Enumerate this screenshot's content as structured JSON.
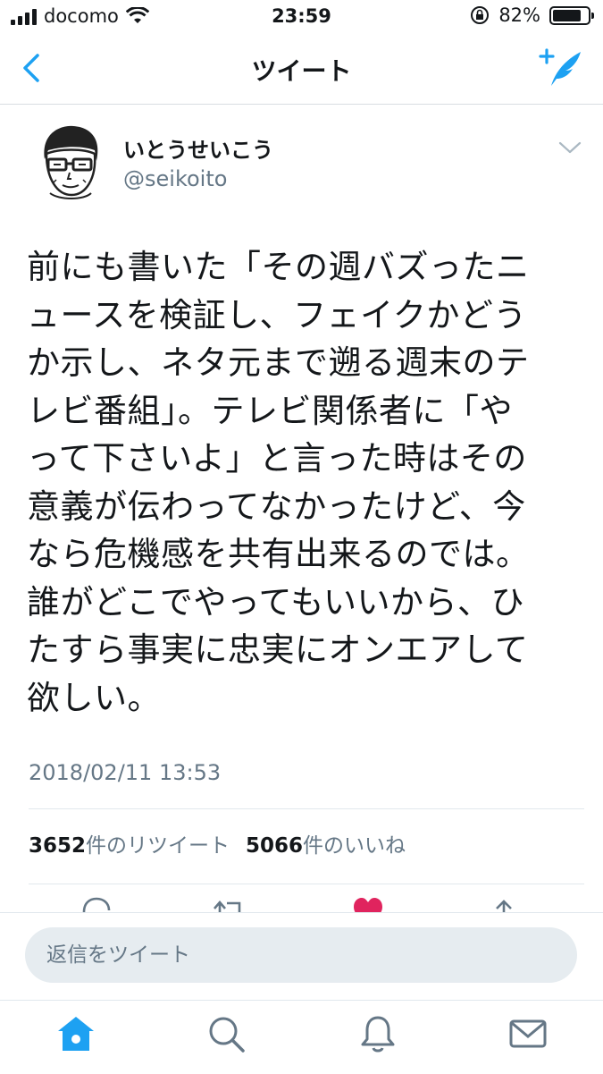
{
  "status_bar": {
    "carrier": "docomo",
    "time": "23:59",
    "battery": "82%",
    "battery_level": 0.82
  },
  "nav": {
    "title": "ツイート",
    "back_icon": "chevron-left-icon",
    "compose_icon": "compose-tweet-icon"
  },
  "tweet": {
    "display_name": "いとうせいこう",
    "handle": "@seikoito",
    "text": "前にも書いた「その週バズったニュースを検証し、フェイクかどうか示し、ネタ元まで遡る週末のテレビ番組」。テレビ関係者に「やって下さいよ」と言った時はその意義が伝わってなかったけど、今なら危機感を共有出来るのでは。誰がどこでやってもいいから、ひたすら事実に忠実にオンエアして欲しい。",
    "lines": [
      "前にも書いた「その週バズったニ",
      "ュースを検証し、フェイクかどう",
      "か示し、ネタ元まで遡る週末のテ",
      "レビ番組」。テレビ関係者に「や",
      "って下さいよ」と言った時はその",
      "意義が伝わってなかったけど、今",
      "なら危機感を共有出来るのでは。",
      "誰がどこでやってもいいから、ひ",
      "たすら事実に忠実にオンエアして",
      "欲しい。"
    ],
    "timestamp": "2018/02/11 13:53",
    "retweets_count": "3652",
    "retweets_label": "件のリツイート",
    "likes_count": "5066",
    "likes_label": "件のいいね"
  },
  "reply": {
    "placeholder": "返信をツイート"
  },
  "colors": {
    "accent": "#1da1f2",
    "secondary_text": "#657786",
    "like": "#e0245e",
    "input_bg": "#e6ecf0"
  },
  "tabs": [
    {
      "icon": "home-icon",
      "active": true
    },
    {
      "icon": "search-icon",
      "active": false
    },
    {
      "icon": "notifications-icon",
      "active": false
    },
    {
      "icon": "messages-icon",
      "active": false
    }
  ]
}
